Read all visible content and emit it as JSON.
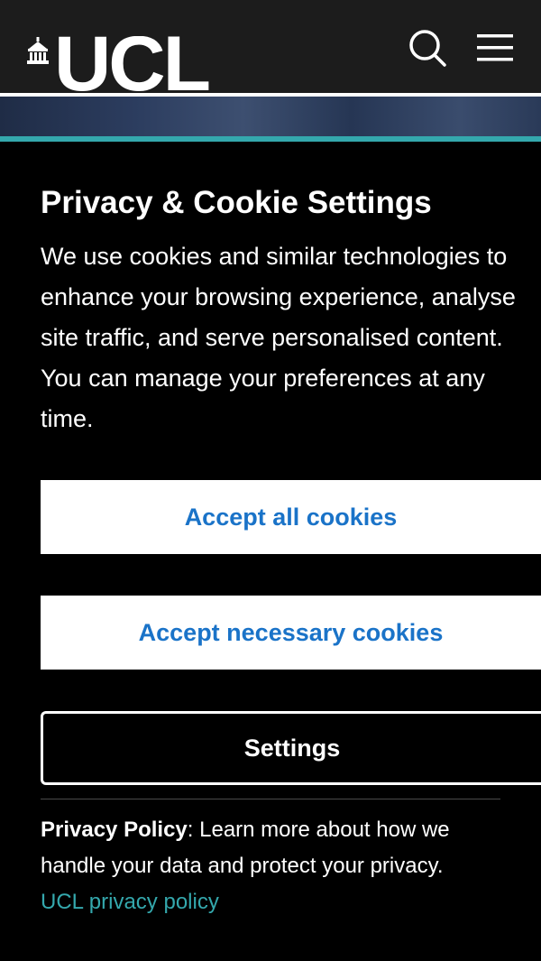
{
  "header": {
    "logo_text": "UCL",
    "search_icon": "search-icon",
    "menu_icon": "hamburger-menu-icon"
  },
  "cookie_banner": {
    "title": "Privacy & Cookie Settings",
    "description": "We use cookies and similar technologies to enhance your browsing experience, analyse site traffic, and serve personalised content. You can manage your preferences at any time.",
    "accept_all_label": "Accept all cookies",
    "accept_necessary_label": "Accept necessary cookies",
    "settings_label": "Settings",
    "policy": {
      "heading": "Privacy Policy",
      "separator": ":",
      "text": " Learn more about how we handle your data and protect your privacy.",
      "link_label": "UCL privacy policy"
    }
  },
  "colors": {
    "header_bg": "#1c1c1c",
    "panel_bg": "#000000",
    "accent_teal": "#34a8ad",
    "button_text_blue": "#1a73c8",
    "text_white": "#ffffff"
  }
}
